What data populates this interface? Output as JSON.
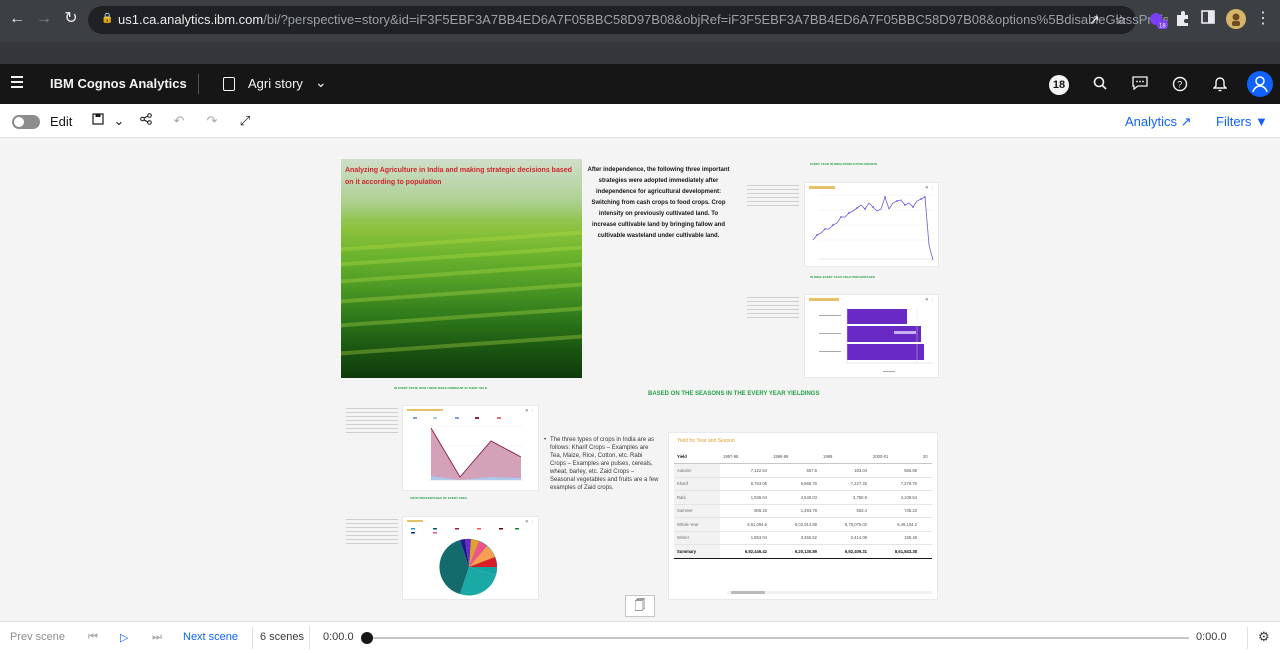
{
  "browser": {
    "url_host": "us1.ca.analytics.ibm.com",
    "url_rest": "/bi/?perspective=story&id=iF3F5EBF3A7BB4ED6A7F05BBC58D97B08&objRef=iF3F5EBF3A7BB4ED6A7F05BBC58D97B08&options%5BdisableGlassPrefetch%5D=t...",
    "ext_badge": "18"
  },
  "appbar": {
    "brand": "IBM Cognos Analytics",
    "story_title": "Agri story",
    "notif_count": "18"
  },
  "toolbar": {
    "edit_label": "Edit",
    "analytics_label": "Analytics",
    "filters_label": "Filters"
  },
  "scene": {
    "image_title": "Analyzing Agriculture in India and making strategic decisions based on it according to population",
    "intro_text": "After independence, the following three important strategies were adopted immediately after independence for agricultural development: Switching from cash crops to food crops. Crop intensity on previously cultivated land. To increase cultivable land by bringing fallow and cultivable wasteland under cultivable land.",
    "label_production": "EVERY YEAR IN INDIA PRODUCTION GROWTH",
    "label_yield_percent": "IN INDIA EVERY YEAR YIELD PERCENTAGES",
    "label_seasons_small": "IN EVERY STATE HOW THESE MAKE DOMINANT IN THEIR YIELD",
    "label_crop_percent": "CROP PERCENTAGES OF EVERY AREA",
    "seasons_heading": "BASED ON THE SEASONS IN THE EVERY YEAR  YIELDINGS",
    "crops_text": "The three types of crops in India are as follows: Kharif Crops – Examples are Tea, Maize, Rice, Cotton, etc. Rabi Crops – Examples are pulses, cereals, wheat, barley, etc. Zaid Crops – Seasonal vegetables and fruits are a few examples of Zaid crops."
  },
  "yield_table": {
    "title": "Yield for Year and Season",
    "header": [
      "Yield",
      "1997-98",
      "1998-99",
      "1999",
      "2000-01",
      "20"
    ],
    "rows": [
      {
        "label": "Autumn",
        "values": [
          "7,122.64",
          "557.6",
          "163.04",
          "556.59"
        ]
      },
      {
        "label": "Kharif",
        "values": [
          "6,763.05",
          "6,868.76",
          "7,227.26",
          "7,379.75"
        ]
      },
      {
        "label": "Rabi",
        "values": [
          "1,936.04",
          "4,540.03",
          "3,750.9",
          "4,109.54"
        ]
      },
      {
        "label": "Summer",
        "values": [
          "806.16",
          "1,493.78",
          "563.4",
          "745.22"
        ]
      },
      {
        "label": "Whole Year",
        "values": [
          "6,61,094.6",
          "6,02,914.89",
          "6,78,075.02",
          "8,49,104.2"
        ]
      },
      {
        "label": "Winter",
        "values": [
          "1,853.04",
          "3,455.52",
          "2,414.08",
          "158.48"
        ]
      }
    ],
    "summary": {
      "label": "Summary",
      "values": [
        "6,92,446.42",
        "6,20,130.89",
        "6,92,409.31",
        "8,61,843.38"
      ]
    }
  },
  "playbar": {
    "prev_label": "Prev scene",
    "next_label": "Next scene",
    "scenes_count": "6 scenes",
    "time_start": "0:00.0",
    "time_end": "0:00.0"
  }
}
